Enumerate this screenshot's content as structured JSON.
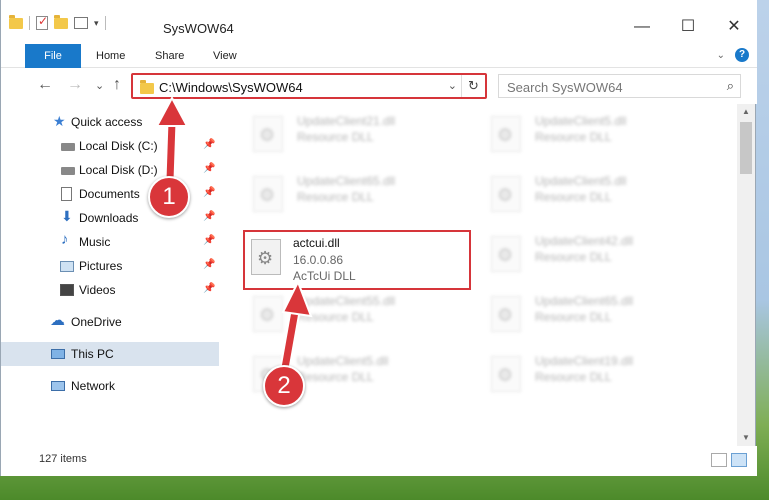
{
  "window": {
    "title": "SysWOW64",
    "minimize": "—",
    "maximize": "☐",
    "close": "✕"
  },
  "ribbon": {
    "tabs": [
      "File",
      "Home",
      "Share",
      "View"
    ],
    "collapse": "⌄",
    "help": "?"
  },
  "nav": {
    "back": "←",
    "forward": "→",
    "recent": "⌄",
    "up": "↑",
    "address": "C:\\Windows\\SysWOW64",
    "address_dropdown": "⌄",
    "refresh": "↻",
    "search_placeholder": "Search SysWOW64",
    "search_icon": "⌕"
  },
  "sidebar": {
    "items": [
      {
        "label": "Quick access",
        "icon": "star-icon"
      },
      {
        "label": "Local Disk (C:)",
        "icon": "drive-icon",
        "pinned": true
      },
      {
        "label": "Local Disk (D:)",
        "icon": "drive-icon",
        "pinned": true
      },
      {
        "label": "Documents",
        "icon": "documents-icon",
        "pinned": true
      },
      {
        "label": "Downloads",
        "icon": "download-icon",
        "pinned": true
      },
      {
        "label": "Music",
        "icon": "music-icon",
        "pinned": true
      },
      {
        "label": "Pictures",
        "icon": "pictures-icon",
        "pinned": true
      },
      {
        "label": "Videos",
        "icon": "videos-icon",
        "pinned": true
      },
      {
        "label": "OneDrive",
        "icon": "cloud-icon"
      },
      {
        "label": "This PC",
        "icon": "computer-icon",
        "selected": true
      },
      {
        "label": "Network",
        "icon": "network-icon"
      }
    ],
    "pin_glyph": "📌"
  },
  "files": {
    "left": [
      {
        "name": "UpdateClient21.dll",
        "desc": "Resource DLL"
      },
      {
        "name": "UpdateClient65.dll",
        "desc": "Resource DLL"
      },
      {
        "name": "UpdateClient55.dll",
        "desc": "Resource DLL"
      },
      {
        "name": "UpdateClient5.dll",
        "desc": "Resource DLL"
      }
    ],
    "right": [
      {
        "name": "UpdateClient5.dll",
        "desc": "Resource DLL"
      },
      {
        "name": "UpdateClient5.dll",
        "desc": "Resource DLL"
      },
      {
        "name": "UpdateClient42.dll",
        "desc": "Resource DLL"
      },
      {
        "name": "UpdateClient65.dll",
        "desc": "Resource DLL"
      },
      {
        "name": "UpdateClient19.dll",
        "desc": "Resource DLL"
      }
    ],
    "highlighted": {
      "name": "actcui.dll",
      "version": "16.0.0.86",
      "desc": "AcTcUi DLL"
    }
  },
  "status": {
    "item_count": "127 items"
  },
  "annotations": {
    "step1": "1",
    "step2": "2",
    "accent": "#d6353a"
  }
}
